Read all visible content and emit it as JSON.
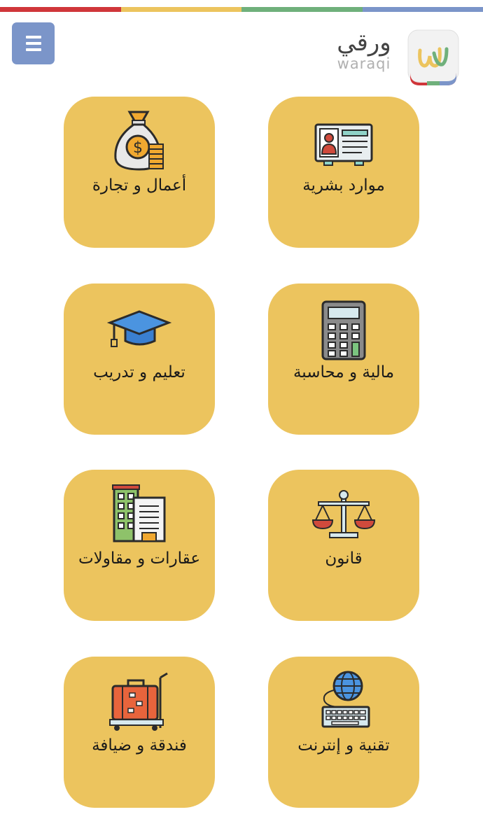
{
  "top_stripe_colors": [
    "#d0363a",
    "#ecc45e",
    "#6fb07b",
    "#7b95c9"
  ],
  "header": {
    "logo_ar": "ورقي",
    "logo_en": "waraqi",
    "menu_icon": "hamburger-menu-icon"
  },
  "categories": [
    {
      "label": "موارد بشرية",
      "icon": "id-card-icon"
    },
    {
      "label": "أعمال و تجارة",
      "icon": "money-bag-icon"
    },
    {
      "label": "مالية و محاسبة",
      "icon": "calculator-icon"
    },
    {
      "label": "تعليم و تدريب",
      "icon": "graduation-cap-icon"
    },
    {
      "label": "قانون",
      "icon": "scales-icon"
    },
    {
      "label": "عقارات و مقاولات",
      "icon": "buildings-icon"
    },
    {
      "label": "تقنية و إنترنت",
      "icon": "globe-keyboard-icon"
    },
    {
      "label": "فندقة و ضيافة",
      "icon": "luggage-icon"
    }
  ],
  "colors": {
    "tile": "#ecc45e",
    "menu_button": "#7b95c9"
  }
}
